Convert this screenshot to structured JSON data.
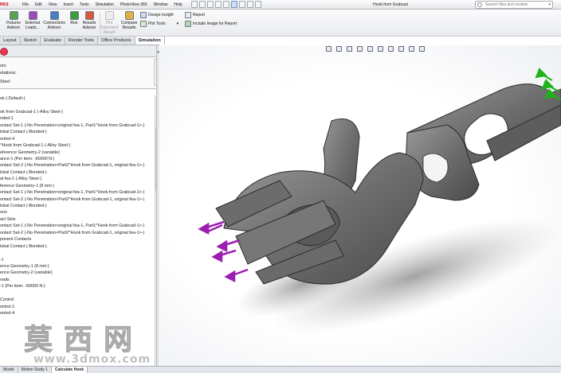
{
  "app": {
    "logo": "RKS",
    "document_title": "Hook from Grabcad"
  },
  "menu": [
    "File",
    "Edit",
    "View",
    "Insert",
    "Tools",
    "Simulation",
    "PhotoView 360",
    "Window",
    "Help"
  ],
  "search": {
    "placeholder": "Search files and models"
  },
  "ribbon": {
    "fixtures_advisor": "Fixtures\nAdvisor",
    "external_loads": "External\nLoads...",
    "connections_advisor": "Connections\nAdvisor",
    "run": "Run",
    "results_advisor": "Results\nAdvisor",
    "plot_deformed_result": "Plot\nDeformed\nResult",
    "compare_results": "Compare\nResults",
    "design_insight": "Design Insight",
    "plot_tools": "Plot Tools",
    "report": "Report",
    "include_image": "Include Image for Report"
  },
  "command_tabs": [
    "Layout",
    "Sketch",
    "Evaluate",
    "Render Tools",
    "Office Products",
    "Simulation"
  ],
  "filter": {
    "row1": "ors",
    "row2": "otations:",
    "row3": "Steel"
  },
  "tree": [
    "ok (-Default-)",
    "",
    "ok from Grabcad-1 (-Alloy Steel-)",
    "nded-1",
    "ontact Set-1 (-No Penetration<original fea-1, Part1^Hook from Grabcad-1>-)",
    "lobal Contact (-Bonded-)",
    "ontrol-4",
    "^Hook from Grabcad-1 (-Alloy Steel-)",
    "eference Geometry-2 (variable)",
    "ance-1 (Per item: -60000 N:)",
    "ontact Set-2 (-No Penetration<Part2^Hook from Grabcad-1, original fea-1>-)",
    "lobal Contact (-Bonded-)",
    "al fea-1 (-Alloy Steel-)",
    "ference Geometry-1 (8 mm:)",
    "ontact Set-1 (-No Penetration<original fea-1, Part1^Hook from Grabcad-1>-)",
    "ontact Set-2 (-No Penetration<Part2^Hook from Grabcad-1, original fea-1>-)",
    "lobal Contact (-Bonded-)",
    "ons",
    "act Sets",
    "ontact Set-1 (-No Penetration<original fea-1, Part1^Hook from Grabcad-1>-)",
    "ontact Set-2 (-No Penetration<Part2^Hook from Grabcad-1, original fea-1>-)",
    "ponent Contacts",
    "lobal Contact (-Bonded-)",
    "",
    "-1",
    "ence Geometry-1 (8 mm:)",
    "ence Geometry-2 (variable)",
    "oads",
    "-1 (Per item: -60000 N:)",
    "",
    "Control",
    "ontrol-1",
    "ontrol-4"
  ],
  "bottom_tabs": [
    "Model",
    "Motion Study 1",
    "Calculate Hook"
  ],
  "watermark": {
    "chars": "莫西网",
    "url": "www.3dmox.com"
  },
  "colors": {
    "arrow_purple": "#9b1fb0",
    "fixture_green": "#1fb21a",
    "part_grey": "#707070"
  }
}
